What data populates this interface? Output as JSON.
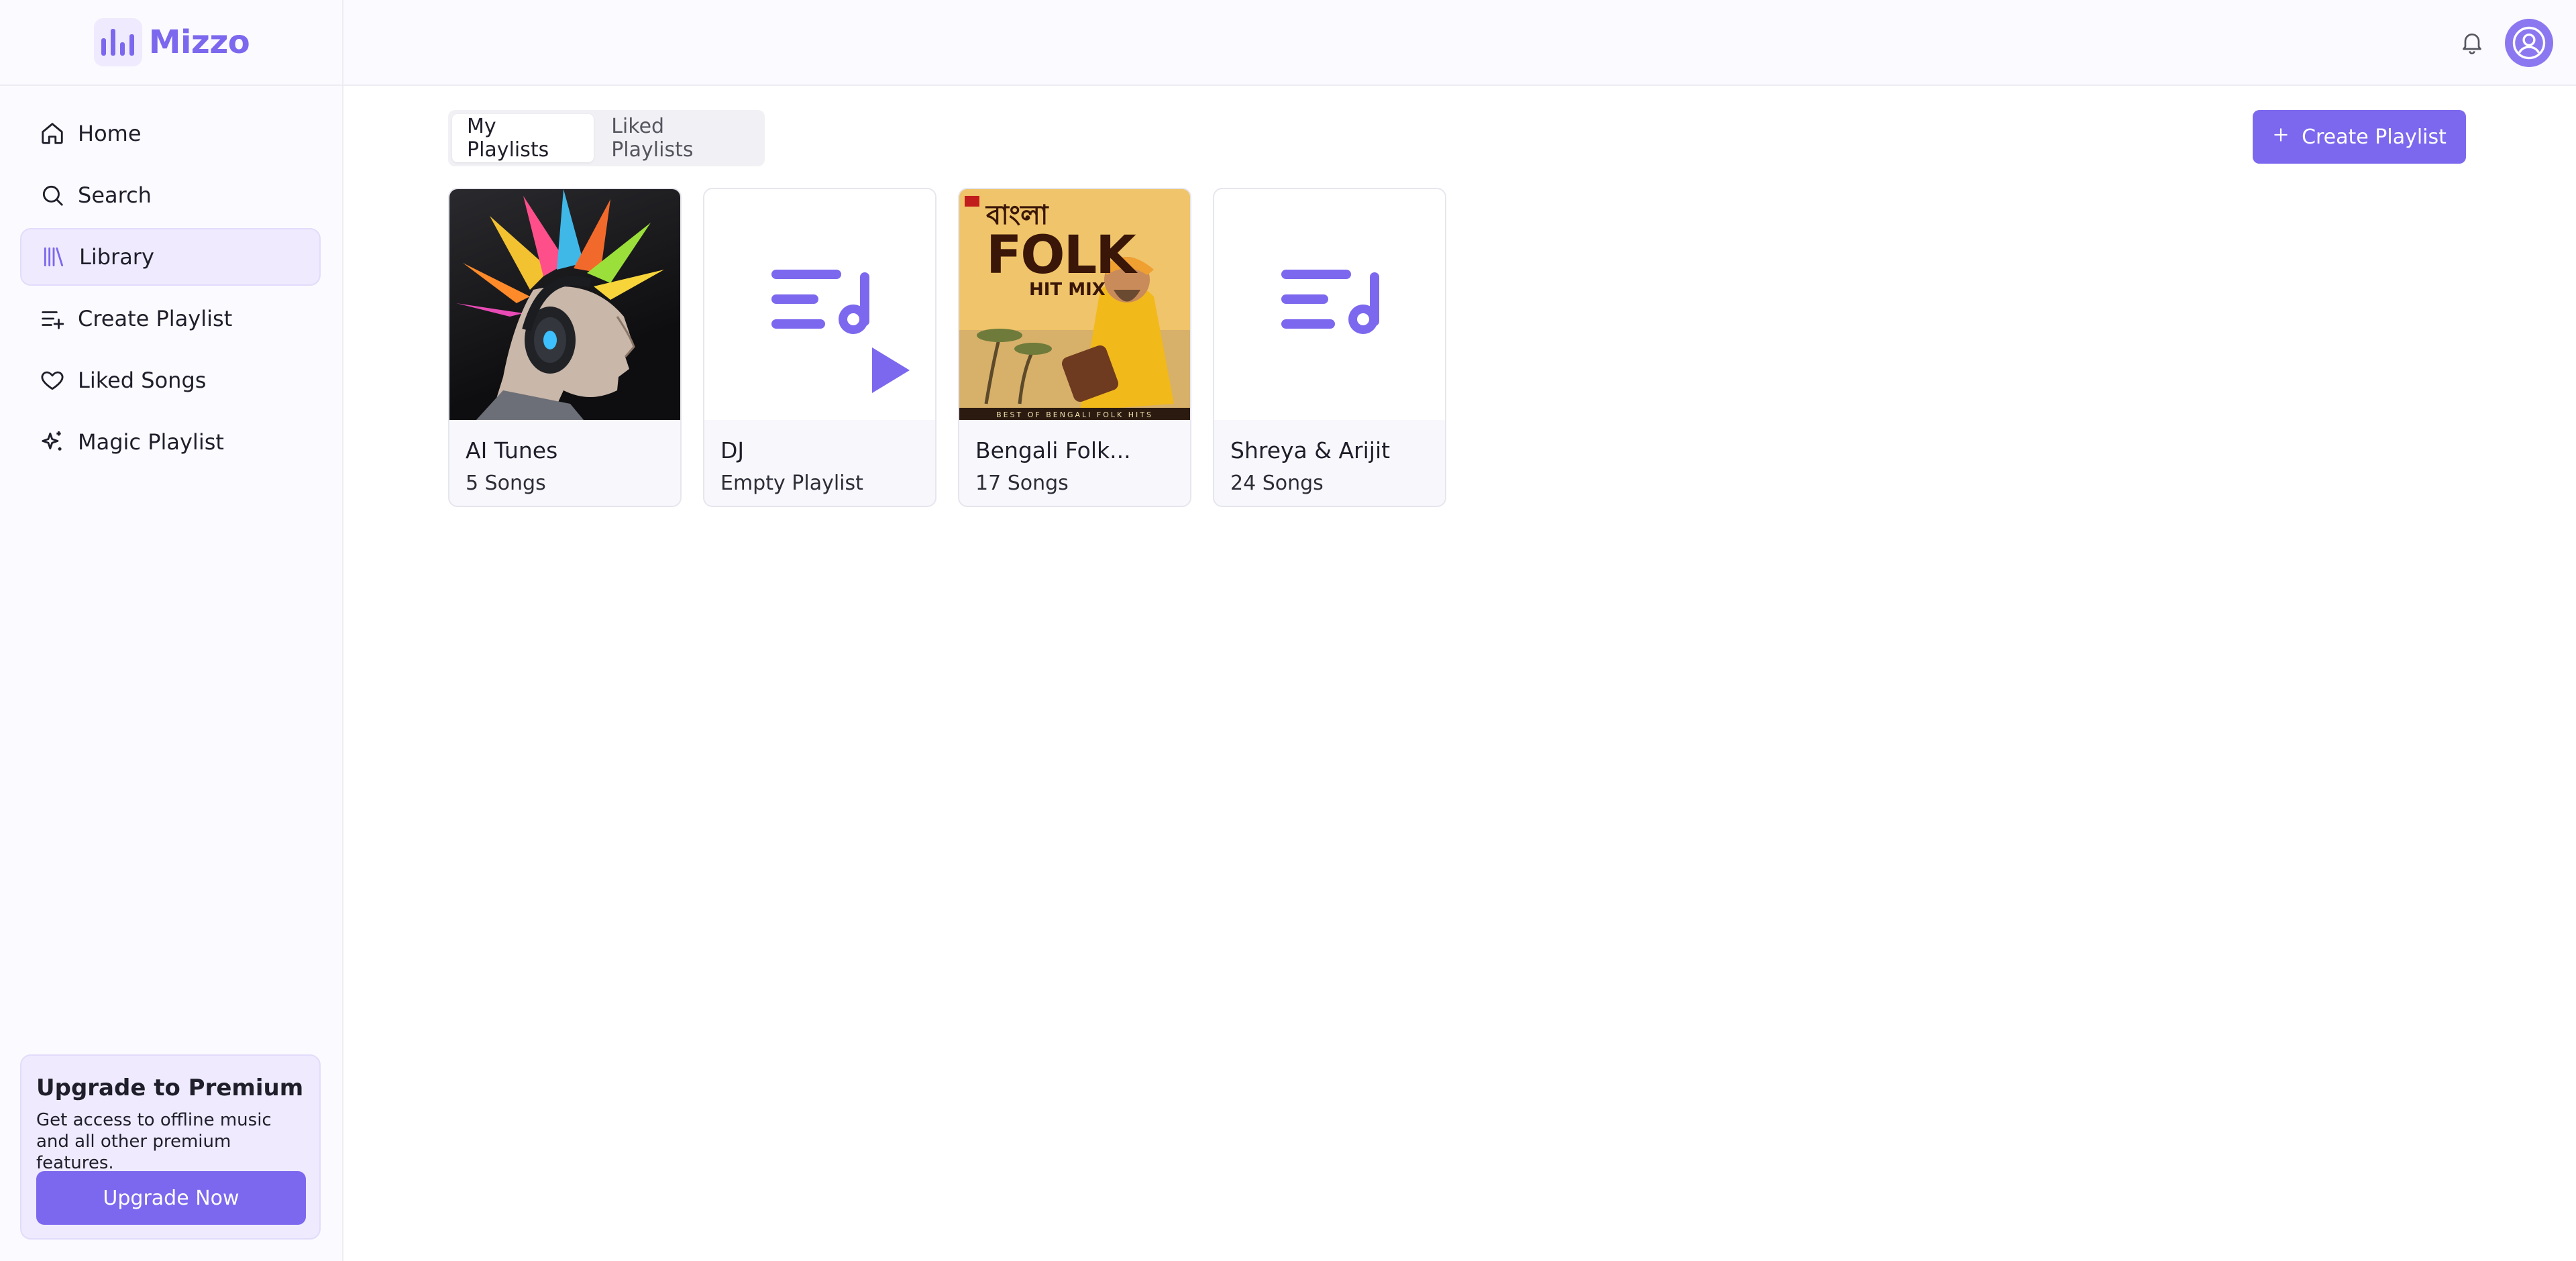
{
  "app": {
    "name": "Mizzo"
  },
  "sidebar": {
    "items": [
      {
        "label": "Home",
        "icon": "home-icon"
      },
      {
        "label": "Search",
        "icon": "search-icon"
      },
      {
        "label": "Library",
        "icon": "library-icon",
        "active": true
      },
      {
        "label": "Create Playlist",
        "icon": "playlist-add-icon"
      },
      {
        "label": "Liked Songs",
        "icon": "heart-icon"
      },
      {
        "label": "Magic Playlist",
        "icon": "sparkle-icon"
      }
    ],
    "upgrade": {
      "title": "Upgrade to Premium",
      "description": "Get access to offline music and all other premium features.",
      "button": "Upgrade Now"
    }
  },
  "header": {
    "icons": [
      "bell-icon",
      "user-avatar-icon"
    ]
  },
  "main": {
    "tabs": [
      {
        "label": "My Playlists",
        "active": true
      },
      {
        "label": "Liked Playlists",
        "active": false
      }
    ],
    "create_button": "Create Playlist",
    "playlists": [
      {
        "title": "AI Tunes",
        "subtitle": "5 Songs",
        "art": "ai-punk-headphones-image"
      },
      {
        "title": "DJ",
        "subtitle": "Empty Playlist",
        "art": "playlist-play-icon"
      },
      {
        "title": "Bengali Folk...",
        "subtitle": "17 Songs",
        "art": "bengali-folk-hit-mix-cover",
        "cover_text": [
          "বাংলা",
          "FOLK",
          "HIT MIX",
          "BEST OF BENGALI FOLK HITS"
        ]
      },
      {
        "title": "Shreya & Arijit",
        "subtitle": "24 Songs",
        "art": "playlist-music-icon"
      }
    ]
  },
  "colors": {
    "accent": "#7c68ee",
    "accent_light": "#efeafe",
    "border": "#e6e6ee"
  }
}
